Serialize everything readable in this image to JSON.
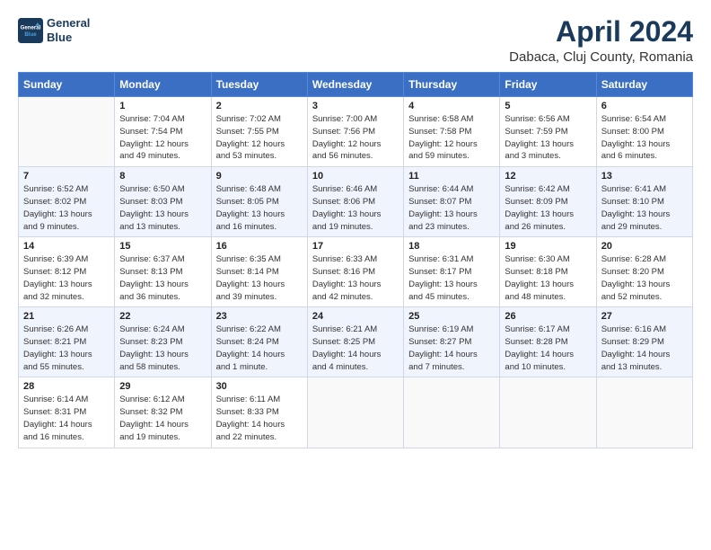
{
  "header": {
    "logo_line1": "General",
    "logo_line2": "Blue",
    "title": "April 2024",
    "subtitle": "Dabaca, Cluj County, Romania"
  },
  "days_of_week": [
    "Sunday",
    "Monday",
    "Tuesday",
    "Wednesday",
    "Thursday",
    "Friday",
    "Saturday"
  ],
  "weeks": [
    [
      {
        "day": "",
        "info": ""
      },
      {
        "day": "1",
        "info": "Sunrise: 7:04 AM\nSunset: 7:54 PM\nDaylight: 12 hours\nand 49 minutes."
      },
      {
        "day": "2",
        "info": "Sunrise: 7:02 AM\nSunset: 7:55 PM\nDaylight: 12 hours\nand 53 minutes."
      },
      {
        "day": "3",
        "info": "Sunrise: 7:00 AM\nSunset: 7:56 PM\nDaylight: 12 hours\nand 56 minutes."
      },
      {
        "day": "4",
        "info": "Sunrise: 6:58 AM\nSunset: 7:58 PM\nDaylight: 12 hours\nand 59 minutes."
      },
      {
        "day": "5",
        "info": "Sunrise: 6:56 AM\nSunset: 7:59 PM\nDaylight: 13 hours\nand 3 minutes."
      },
      {
        "day": "6",
        "info": "Sunrise: 6:54 AM\nSunset: 8:00 PM\nDaylight: 13 hours\nand 6 minutes."
      }
    ],
    [
      {
        "day": "7",
        "info": "Sunrise: 6:52 AM\nSunset: 8:02 PM\nDaylight: 13 hours\nand 9 minutes."
      },
      {
        "day": "8",
        "info": "Sunrise: 6:50 AM\nSunset: 8:03 PM\nDaylight: 13 hours\nand 13 minutes."
      },
      {
        "day": "9",
        "info": "Sunrise: 6:48 AM\nSunset: 8:05 PM\nDaylight: 13 hours\nand 16 minutes."
      },
      {
        "day": "10",
        "info": "Sunrise: 6:46 AM\nSunset: 8:06 PM\nDaylight: 13 hours\nand 19 minutes."
      },
      {
        "day": "11",
        "info": "Sunrise: 6:44 AM\nSunset: 8:07 PM\nDaylight: 13 hours\nand 23 minutes."
      },
      {
        "day": "12",
        "info": "Sunrise: 6:42 AM\nSunset: 8:09 PM\nDaylight: 13 hours\nand 26 minutes."
      },
      {
        "day": "13",
        "info": "Sunrise: 6:41 AM\nSunset: 8:10 PM\nDaylight: 13 hours\nand 29 minutes."
      }
    ],
    [
      {
        "day": "14",
        "info": "Sunrise: 6:39 AM\nSunset: 8:12 PM\nDaylight: 13 hours\nand 32 minutes."
      },
      {
        "day": "15",
        "info": "Sunrise: 6:37 AM\nSunset: 8:13 PM\nDaylight: 13 hours\nand 36 minutes."
      },
      {
        "day": "16",
        "info": "Sunrise: 6:35 AM\nSunset: 8:14 PM\nDaylight: 13 hours\nand 39 minutes."
      },
      {
        "day": "17",
        "info": "Sunrise: 6:33 AM\nSunset: 8:16 PM\nDaylight: 13 hours\nand 42 minutes."
      },
      {
        "day": "18",
        "info": "Sunrise: 6:31 AM\nSunset: 8:17 PM\nDaylight: 13 hours\nand 45 minutes."
      },
      {
        "day": "19",
        "info": "Sunrise: 6:30 AM\nSunset: 8:18 PM\nDaylight: 13 hours\nand 48 minutes."
      },
      {
        "day": "20",
        "info": "Sunrise: 6:28 AM\nSunset: 8:20 PM\nDaylight: 13 hours\nand 52 minutes."
      }
    ],
    [
      {
        "day": "21",
        "info": "Sunrise: 6:26 AM\nSunset: 8:21 PM\nDaylight: 13 hours\nand 55 minutes."
      },
      {
        "day": "22",
        "info": "Sunrise: 6:24 AM\nSunset: 8:23 PM\nDaylight: 13 hours\nand 58 minutes."
      },
      {
        "day": "23",
        "info": "Sunrise: 6:22 AM\nSunset: 8:24 PM\nDaylight: 14 hours\nand 1 minute."
      },
      {
        "day": "24",
        "info": "Sunrise: 6:21 AM\nSunset: 8:25 PM\nDaylight: 14 hours\nand 4 minutes."
      },
      {
        "day": "25",
        "info": "Sunrise: 6:19 AM\nSunset: 8:27 PM\nDaylight: 14 hours\nand 7 minutes."
      },
      {
        "day": "26",
        "info": "Sunrise: 6:17 AM\nSunset: 8:28 PM\nDaylight: 14 hours\nand 10 minutes."
      },
      {
        "day": "27",
        "info": "Sunrise: 6:16 AM\nSunset: 8:29 PM\nDaylight: 14 hours\nand 13 minutes."
      }
    ],
    [
      {
        "day": "28",
        "info": "Sunrise: 6:14 AM\nSunset: 8:31 PM\nDaylight: 14 hours\nand 16 minutes."
      },
      {
        "day": "29",
        "info": "Sunrise: 6:12 AM\nSunset: 8:32 PM\nDaylight: 14 hours\nand 19 minutes."
      },
      {
        "day": "30",
        "info": "Sunrise: 6:11 AM\nSunset: 8:33 PM\nDaylight: 14 hours\nand 22 minutes."
      },
      {
        "day": "",
        "info": ""
      },
      {
        "day": "",
        "info": ""
      },
      {
        "day": "",
        "info": ""
      },
      {
        "day": "",
        "info": ""
      }
    ]
  ]
}
